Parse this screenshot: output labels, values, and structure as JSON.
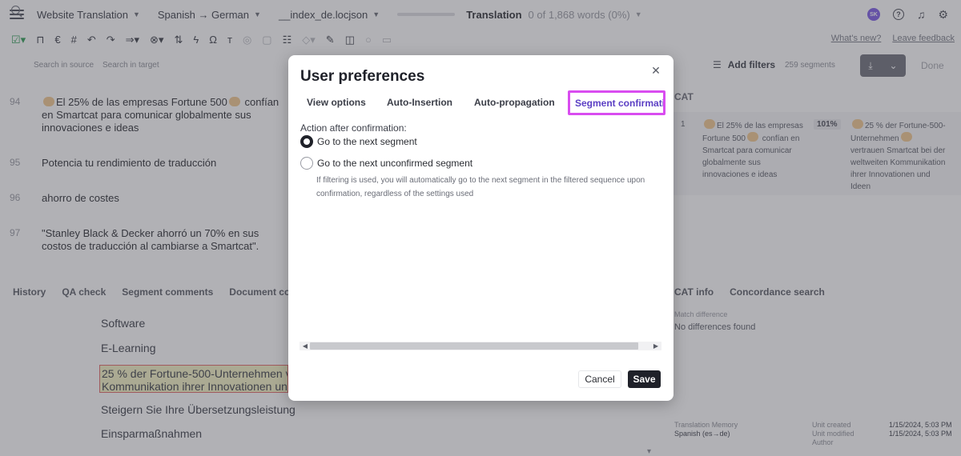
{
  "header": {
    "project": "Website Translation",
    "languages": "Spanish → German",
    "file": "__index_de.locjson",
    "stage": "Translation",
    "words": "0 of 1,868 words (0%)",
    "avatar_initials": "SK"
  },
  "toolbar": {
    "links": [
      "What's new?",
      "Leave feedback"
    ]
  },
  "search": {
    "source_placeholder": "Search in source",
    "target_placeholder": "Search in target",
    "filters_label": "Add filters",
    "segment_count": "259 segments",
    "done_label": "Done"
  },
  "segments": [
    {
      "num": "94",
      "pre": "",
      "text": "El 25% de las empresas Fortune 500",
      "post": " confían en Smartcat para comunicar globalmente sus innovaciones e ideas"
    },
    {
      "num": "95",
      "text": "Potencia tu rendimiento de traducción"
    },
    {
      "num": "96",
      "text": "ahorro de costes"
    },
    {
      "num": "97",
      "text": "\"Stanley Black & Decker ahorró un 70% en sus costos de traducción al cambiarse a Smartcat\"."
    }
  ],
  "bottom_tabs": [
    "History",
    "QA check",
    "Segment comments",
    "Document comm"
  ],
  "cat_tabs": [
    "CAT info",
    "Concordance search"
  ],
  "targets": [
    "Software",
    "E-Learning",
    "Steigern Sie Ihre Übersetzungsleistung",
    "Einsparmaßnahmen"
  ],
  "target_active": {
    "line1": "25 % der Fortune-500-Unternehmen v",
    "line2": "Kommunikation ihrer Innovationen un"
  },
  "cat": {
    "header": "CAT",
    "num": "1",
    "source_a": "El 25% de las empresas Fortune 500",
    "source_b": " confían en Smartcat para comunicar globalmente sus innovaciones e ideas",
    "match": "101%",
    "target_a": "25 % der Fortune-500-Unternehmen",
    "target_b": " vertrauen Smartcat bei der weltweiten Kommunikation ihrer Innovationen und Ideen",
    "match_label": "Match difference",
    "match_value": "No differences found",
    "tm_label": "Translation Memory",
    "tm_value": "Spanish (es→de)",
    "unit_created": "Unit created",
    "unit_modified": "Unit modified",
    "author": "Author",
    "created_date": "1/15/2024, 5:03 PM",
    "modified_date": "1/15/2024, 5:03 PM"
  },
  "modal": {
    "title": "User preferences",
    "tabs": [
      "View options",
      "Auto-Insertion",
      "Auto-propagation",
      "Segment confirmation"
    ],
    "action_label": "Action after confirmation:",
    "option_next": "Go to the next segment",
    "option_unconfirmed": "Go to the next unconfirmed segment",
    "hint": "If filtering is used, you will automatically go to the next segment in the filtered sequence upon confirmation, regardless of the settings used",
    "selected": "next",
    "cancel": "Cancel",
    "save": "Save"
  },
  "colors": {
    "accent": "#5b3fc4",
    "highlight_border": "#d94cf0",
    "primary_button": "#1f2129"
  }
}
